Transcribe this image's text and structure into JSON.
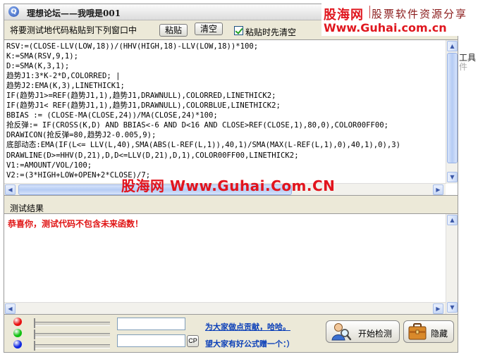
{
  "window": {
    "title": "理想论坛——我哦是001",
    "title_icon": "Q"
  },
  "brand": {
    "name_cn": "股海网",
    "tagline": "股票软件资源分享",
    "url": "Www.Guhai.com.cn"
  },
  "side_peek": {
    "line1": "工具",
    "line2": "件"
  },
  "toolbar": {
    "hint": "将要测试地代码粘贴到下列窗口中",
    "paste_label": "粘贴",
    "clear_label": "清空",
    "clear_before_paste_label": "粘贴时先清空",
    "clear_before_paste_checked": true
  },
  "code_lines": [
    "RSV:=(CLOSE-LLV(LOW,18))/(HHV(HIGH,18)-LLV(LOW,18))*100;",
    "K:=SMA(RSV,9,1);",
    "D:=SMA(K,3,1);",
    "趋势J1:3*K-2*D,COLORRED; |",
    "趋势J2:EMA(K,3),LINETHICK1;",
    "IF(趋势J1>=REF(趋势J1,1),趋势J1,DRAWNULL),COLORRED,LINETHICK2;",
    "IF(趋势J1< REF(趋势J1,1),趋势J1,DRAWNULL),COLORBLUE,LINETHICK2;",
    "BBIAS := (CLOSE-MA(CLOSE,24))/MA(CLOSE,24)*100;",
    "抢反弹:= IF(CROSS(K,D) AND BBIAS<-6 AND D<16 AND CLOSE>REF(CLOSE,1),80,0),COLOR00FF00;",
    "DRAWICON(抢反弹=80,趋势J2-0.005,9);",
    "底部动态:EMA(IF(L<= LLV(L,40),SMA(ABS(L-REF(L,1)),40,1)/SMA(MAX(L-REF(L,1),0),40,1),0),3)",
    "DRAWLINE(D>=HHV(D,21),D,D<=LLV(D,21),D,1),COLOR00FF00,LINETHICK2;",
    "V1:=AMOUNT/VOL/100;",
    "V2:=(3*HIGH+LOW+OPEN+2*CLOSE)/7;"
  ],
  "watermark": "股海网 Www.Guhai.Com.CN",
  "result": {
    "label": "测试结果",
    "message": "恭喜你，测试代码不包含未来函数！"
  },
  "status": {
    "dot_colors": [
      "#e81010",
      "#10c010",
      "#1028e0"
    ],
    "cp_label": "CP",
    "link1": "为大家做点贡献，哈哈。",
    "link2": "望大家有好公式赠一个：）"
  },
  "actions": {
    "start_label": "开始检测",
    "hide_label": "隐藏"
  }
}
